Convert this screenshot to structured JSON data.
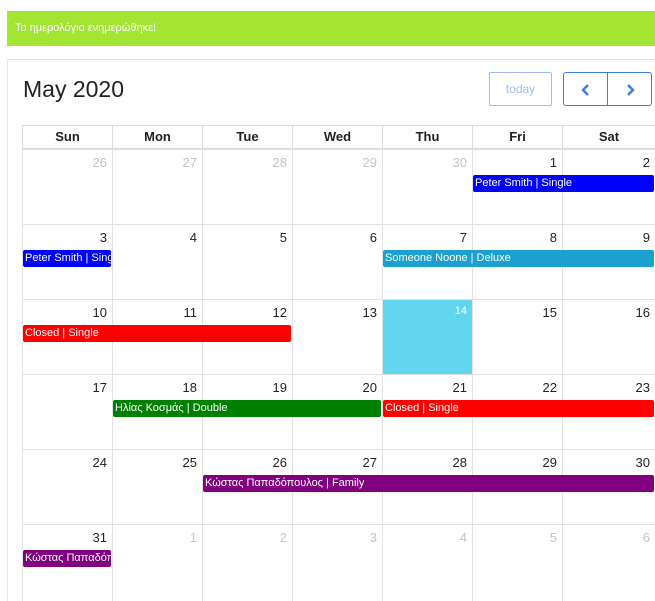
{
  "alert": "Το ημερολόγιο ενημερώθηκε!",
  "title": "May 2020",
  "buttons": {
    "today": "today"
  },
  "days": [
    "Sun",
    "Mon",
    "Tue",
    "Wed",
    "Thu",
    "Fri",
    "Sat"
  ],
  "weeks": [
    [
      {
        "n": "26",
        "o": true
      },
      {
        "n": "27",
        "o": true
      },
      {
        "n": "28",
        "o": true
      },
      {
        "n": "29",
        "o": true
      },
      {
        "n": "30",
        "o": true
      },
      {
        "n": "1"
      },
      {
        "n": "2"
      }
    ],
    [
      {
        "n": "3"
      },
      {
        "n": "4"
      },
      {
        "n": "5"
      },
      {
        "n": "6"
      },
      {
        "n": "7"
      },
      {
        "n": "8"
      },
      {
        "n": "9"
      }
    ],
    [
      {
        "n": "10"
      },
      {
        "n": "11"
      },
      {
        "n": "12"
      },
      {
        "n": "13"
      },
      {
        "n": "14",
        "today": true
      },
      {
        "n": "15"
      },
      {
        "n": "16"
      }
    ],
    [
      {
        "n": "17"
      },
      {
        "n": "18"
      },
      {
        "n": "19"
      },
      {
        "n": "20"
      },
      {
        "n": "21"
      },
      {
        "n": "22"
      },
      {
        "n": "23"
      }
    ],
    [
      {
        "n": "24"
      },
      {
        "n": "25"
      },
      {
        "n": "26"
      },
      {
        "n": "27"
      },
      {
        "n": "28"
      },
      {
        "n": "29"
      },
      {
        "n": "30"
      }
    ],
    [
      {
        "n": "31"
      },
      {
        "n": "1",
        "o": true
      },
      {
        "n": "2",
        "o": true
      },
      {
        "n": "3",
        "o": true
      },
      {
        "n": "4",
        "o": true
      },
      {
        "n": "5",
        "o": true
      },
      {
        "n": "6",
        "o": true
      }
    ]
  ],
  "events": [
    {
      "text": "Peter Smith | Single",
      "color": "#0000ff",
      "week": 0,
      "start": 5,
      "end": 6
    },
    {
      "text": "Peter Smith | Single",
      "color": "#0000ff",
      "week": 1,
      "start": 0,
      "end": 0
    },
    {
      "text": "Someone Noone | Deluxe",
      "color": "#1ba1cf",
      "week": 1,
      "start": 4,
      "end": 6
    },
    {
      "text": "Closed | Single",
      "color": "#ff0000",
      "week": 2,
      "start": 0,
      "end": 2
    },
    {
      "text": "Ηλίας Κοσμάς | Double",
      "color": "#008000",
      "week": 3,
      "start": 1,
      "end": 3
    },
    {
      "text": "Closed | Single",
      "color": "#ff0000",
      "week": 3,
      "start": 4,
      "end": 6
    },
    {
      "text": "Κώστας Παπαδόπουλος | Family",
      "color": "#800080",
      "week": 4,
      "start": 2,
      "end": 6
    },
    {
      "text": "Κώστας Παπαδόπουλος | Family",
      "color": "#800080",
      "week": 5,
      "start": 0,
      "end": 0
    }
  ]
}
